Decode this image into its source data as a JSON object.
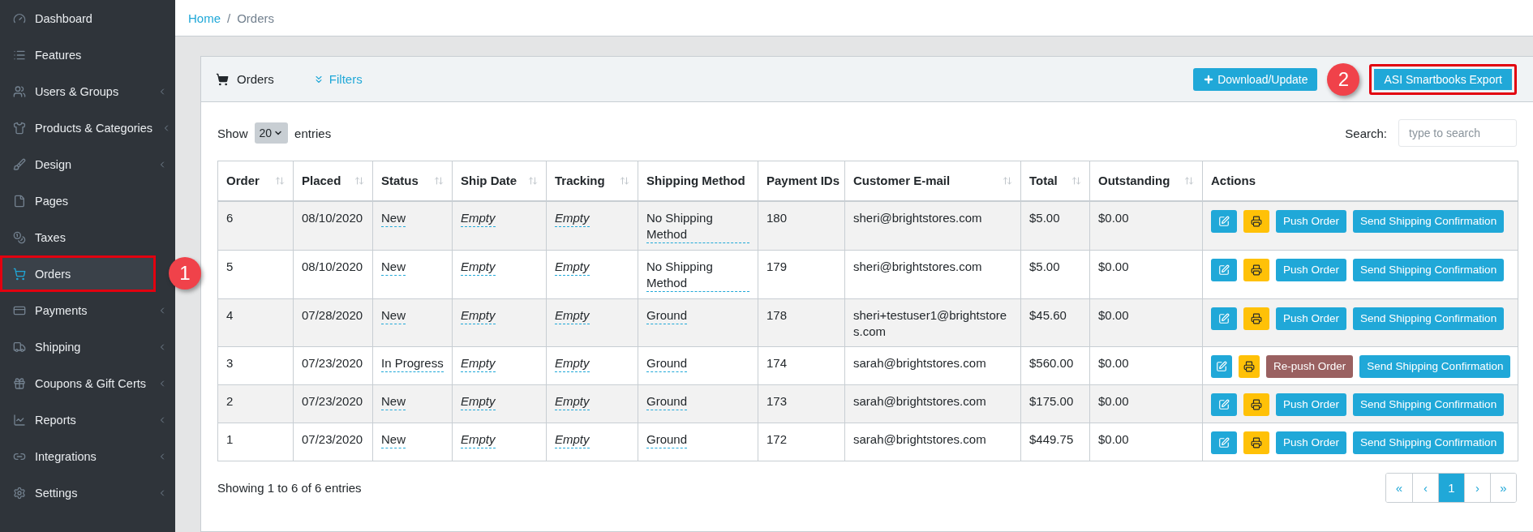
{
  "sidebar": {
    "items": [
      {
        "label": "Dashboard",
        "has_submenu": false,
        "selected": false,
        "highlighted": false
      },
      {
        "label": "Features",
        "has_submenu": false,
        "selected": false,
        "highlighted": false
      },
      {
        "label": "Users & Groups",
        "has_submenu": true,
        "selected": false,
        "highlighted": false
      },
      {
        "label": "Products & Categories",
        "has_submenu": true,
        "selected": false,
        "highlighted": false
      },
      {
        "label": "Design",
        "has_submenu": true,
        "selected": false,
        "highlighted": false
      },
      {
        "label": "Pages",
        "has_submenu": false,
        "selected": false,
        "highlighted": false
      },
      {
        "label": "Taxes",
        "has_submenu": false,
        "selected": false,
        "highlighted": false
      },
      {
        "label": "Orders",
        "has_submenu": false,
        "selected": true,
        "highlighted": true,
        "annotation": "1"
      },
      {
        "label": "Payments",
        "has_submenu": true,
        "selected": false,
        "highlighted": false
      },
      {
        "label": "Shipping",
        "has_submenu": true,
        "selected": false,
        "highlighted": false
      },
      {
        "label": "Coupons & Gift Certs",
        "has_submenu": true,
        "selected": false,
        "highlighted": false
      },
      {
        "label": "Reports",
        "has_submenu": true,
        "selected": false,
        "highlighted": false
      },
      {
        "label": "Integrations",
        "has_submenu": true,
        "selected": false,
        "highlighted": false
      },
      {
        "label": "Settings",
        "has_submenu": true,
        "selected": false,
        "highlighted": false
      }
    ]
  },
  "breadcrumb": [
    {
      "label": "Home",
      "link": true
    },
    {
      "label": "/",
      "link": false
    },
    {
      "label": "Orders",
      "link": false
    }
  ],
  "card": {
    "title": "Orders",
    "filters": "Filters",
    "buttons": [
      {
        "label": "Download/Update",
        "highlighted": false
      },
      {
        "label": "ASI Smartbooks Export",
        "highlighted": true,
        "annotation": "2"
      }
    ]
  },
  "length_menu": {
    "before": "Show",
    "value": "20",
    "after": "entries"
  },
  "search": {
    "label": "Search:",
    "placeholder": "type to search"
  },
  "table": {
    "columns": [
      {
        "label": "Order",
        "sortable": true
      },
      {
        "label": "Placed",
        "sortable": true
      },
      {
        "label": "Status",
        "sortable": true
      },
      {
        "label": "Ship Date",
        "sortable": true
      },
      {
        "label": "Tracking",
        "sortable": true
      },
      {
        "label": "Shipping Method",
        "sortable": false
      },
      {
        "label": "Payment IDs",
        "sortable": false
      },
      {
        "label": "Customer E-mail",
        "sortable": true
      },
      {
        "label": "Total",
        "sortable": true
      },
      {
        "label": "Outstanding",
        "sortable": true
      },
      {
        "label": "Actions",
        "sortable": false
      }
    ],
    "rows": [
      {
        "order": "6",
        "placed": "08/10/2020",
        "status": "New",
        "ship_date": "Empty",
        "tracking": "Empty",
        "shipping_method": "No Shipping Method",
        "payment_ids": "180",
        "email": "sheri@brightstores.com",
        "total": "$5.00",
        "outstanding": "$0.00",
        "push": {
          "label": "Push Order",
          "kind": "push"
        },
        "confirm": "Send Shipping Confirmation"
      },
      {
        "order": "5",
        "placed": "08/10/2020",
        "status": "New",
        "ship_date": "Empty",
        "tracking": "Empty",
        "shipping_method": "No Shipping Method",
        "payment_ids": "179",
        "email": "sheri@brightstores.com",
        "total": "$5.00",
        "outstanding": "$0.00",
        "push": {
          "label": "Push Order",
          "kind": "push"
        },
        "confirm": "Send Shipping Confirmation"
      },
      {
        "order": "4",
        "placed": "07/28/2020",
        "status": "New",
        "ship_date": "Empty",
        "tracking": "Empty",
        "shipping_method": "Ground",
        "payment_ids": "178",
        "email": "sheri+testuser1@brightstores.com",
        "total": "$45.60",
        "outstanding": "$0.00",
        "push": {
          "label": "Push Order",
          "kind": "push"
        },
        "confirm": "Send Shipping Confirmation"
      },
      {
        "order": "3",
        "placed": "07/23/2020",
        "status": "In Progress",
        "ship_date": "Empty",
        "tracking": "Empty",
        "shipping_method": "Ground",
        "payment_ids": "174",
        "email": "sarah@brightstores.com",
        "total": "$560.00",
        "outstanding": "$0.00",
        "push": {
          "label": "Re-push Order",
          "kind": "repush"
        },
        "confirm": "Send Shipping Confirmation"
      },
      {
        "order": "2",
        "placed": "07/23/2020",
        "status": "New",
        "ship_date": "Empty",
        "tracking": "Empty",
        "shipping_method": "Ground",
        "payment_ids": "173",
        "email": "sarah@brightstores.com",
        "total": "$175.00",
        "outstanding": "$0.00",
        "push": {
          "label": "Push Order",
          "kind": "push"
        },
        "confirm": "Send Shipping Confirmation"
      },
      {
        "order": "1",
        "placed": "07/23/2020",
        "status": "New",
        "ship_date": "Empty",
        "tracking": "Empty",
        "shipping_method": "Ground",
        "payment_ids": "172",
        "email": "sarah@brightstores.com",
        "total": "$449.75",
        "outstanding": "$0.00",
        "push": {
          "label": "Push Order",
          "kind": "push"
        },
        "confirm": "Send Shipping Confirmation"
      }
    ]
  },
  "info": "Showing 1 to 6 of 6 entries",
  "pagination": [
    {
      "label": "«",
      "selected": false
    },
    {
      "label": "‹",
      "selected": false
    },
    {
      "label": "1",
      "selected": true
    },
    {
      "label": "›",
      "selected": false
    },
    {
      "label": "»",
      "selected": false
    }
  ]
}
